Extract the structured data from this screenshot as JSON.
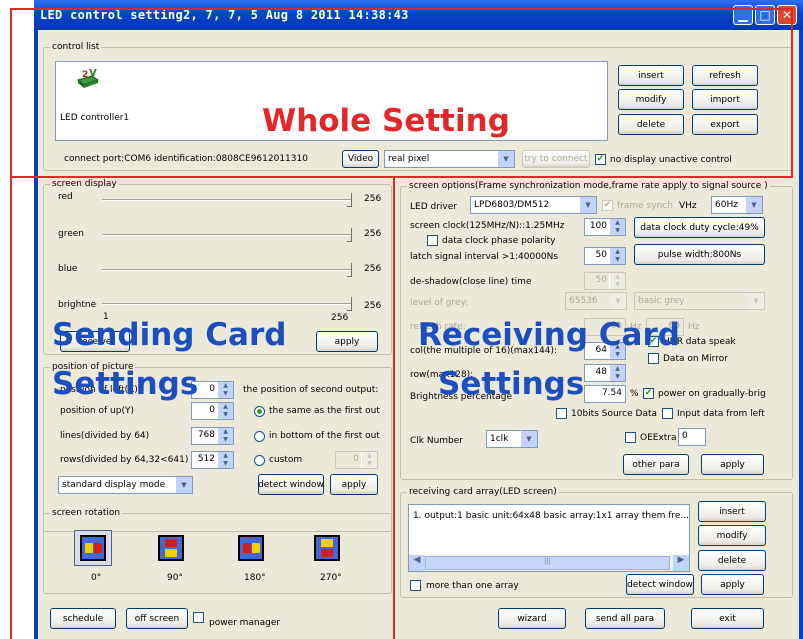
{
  "window": {
    "title": "LED control setting2, 7, 7, 5  Aug  8 2011  14:38:43",
    "min_glyph": "▁",
    "max_glyph": "□",
    "close_glyph": "✕"
  },
  "control_list": {
    "label": "control list",
    "device_name": "LED controller1",
    "buttons": {
      "insert": "insert",
      "refresh": "refresh",
      "modify": "modify",
      "import": "import",
      "delete": "delete",
      "export": "export"
    },
    "connect_port": "connect port:COM6 identification:0808CE9612011310",
    "video": "Video",
    "mode_value": "real pixel",
    "try_connect": "try to connect",
    "no_display": "no display unactive control",
    "checked": "✔"
  },
  "screen_display": {
    "label": "screen display",
    "rows": [
      {
        "name": "red",
        "value": "256"
      },
      {
        "name": "green",
        "value": "256"
      },
      {
        "name": "blue",
        "value": "256"
      },
      {
        "name": "brightne",
        "value": "256"
      }
    ],
    "min": "1",
    "max": "256",
    "receive_btn": "receive",
    "apply": "apply"
  },
  "position": {
    "label": "position of picture",
    "x_label": "position of left(X)",
    "x_value": "0",
    "second_output": "the position of second output:",
    "y_label": "position of up(Y)",
    "y_value": "0",
    "lines_label": "lines(divided by 64)",
    "lines_value": "768",
    "rows_label": "rows(divided by 64,32<641)",
    "rows_value": "512",
    "opt_same": "the same as the first out",
    "opt_bottom": "in bottom of the first out",
    "opt_custom": "custom",
    "custom_value": "0",
    "display_mode": "standard display mode",
    "detect": "detect window",
    "apply": "apply"
  },
  "rotation": {
    "label": "screen rotation",
    "angles": [
      "0°",
      "90°",
      "180°",
      "270°"
    ]
  },
  "bottom_left": {
    "schedule": "schedule",
    "off_screen": "off screen",
    "power_manager": "power manager"
  },
  "screen_options": {
    "label": "screen options(Frame synchronization mode,frame rate apply to signal source )",
    "led_driver_label": "LED driver",
    "led_driver": "LPD6803/DM512",
    "frame_synch": "frame synch",
    "vhz": "VHz",
    "hz": "60Hz",
    "clock_label": "screen clock(125MHz/N)::1.25MHz",
    "clock_value": "100",
    "duty": "data clock duty cycle:49%",
    "phase": "data clock phase polarity",
    "latch_label": "latch signal interval >1:40000Ns",
    "latch_value": "50",
    "pulse": "pulse width:800Ns",
    "deshadow_label": "de-shadow(close line) time",
    "deshadow_value": "50",
    "grey_label": "level of grey:",
    "grey_value": "65536",
    "grey_mode": "basic grey",
    "refresh_label": "refresh rate:",
    "refresh_value": "60",
    "hz_unit": "Hz",
    "refresh_value2": "60",
    "hz_unit2": "Hz",
    "col_label": "col(the multiple of 16)(max144):",
    "col_value": "64",
    "hdr": "HDR data speak",
    "data_mirror": "Data on Mirror",
    "row_label": "row(max128):",
    "row_value": "48",
    "brightness_label": "Brightness percentage",
    "brightness_value": "7.54",
    "pct": "%",
    "power_on": "power on gradually-brig",
    "tenbit": "10bits Source Data",
    "input_left": "Input data from left",
    "clk_label": "Clk Number",
    "clk_value": "1clk",
    "oeextra": "OEExtra",
    "oe_value": "0",
    "other_para": "other para",
    "apply": "apply"
  },
  "receiving": {
    "label": "receiving card array(LED screen)",
    "item": "1. output:1 basic unit:64x48 basic array:1x1 array them fre...",
    "scroll": "|||",
    "more": "more than one array",
    "insert": "insert",
    "modify": "modify",
    "delete": "delete",
    "detect": "detect window",
    "apply": "apply"
  },
  "footer": {
    "wizard": "wizard",
    "send_all": "send all para",
    "exit": "exit"
  },
  "overlays": {
    "whole": "Whole Setting",
    "sending1": "Sending Card",
    "sending2": "Settings",
    "receiving1": "Receiving Card",
    "receiving2": "Settings"
  },
  "colors": {
    "overlay_red": "#e32626",
    "overlay_blue": "#1b4fbf",
    "title_blue": "#0a44cc"
  }
}
